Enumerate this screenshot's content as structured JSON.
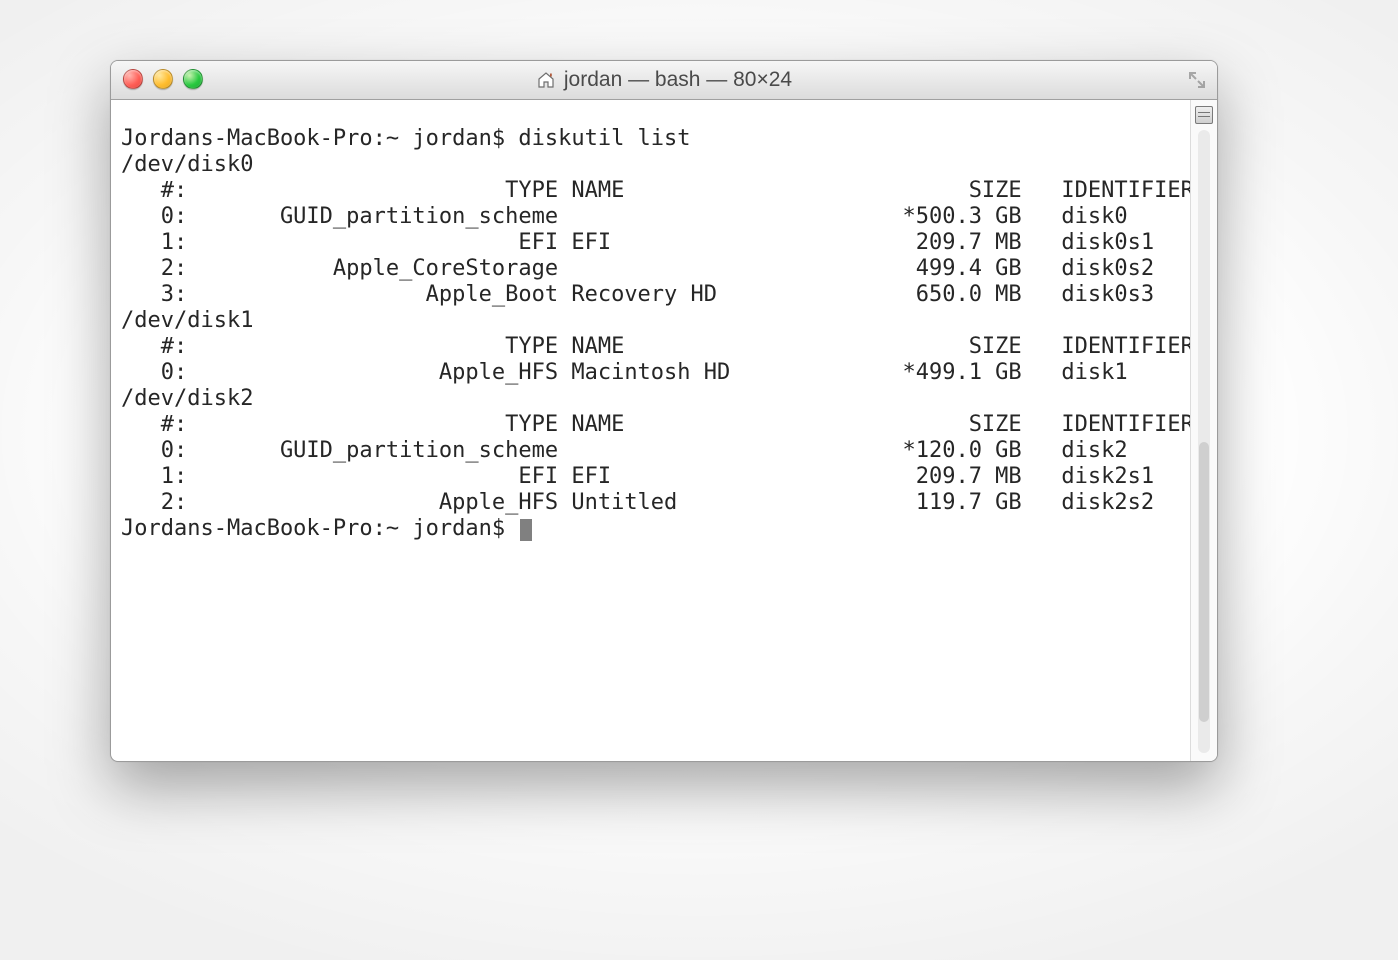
{
  "window": {
    "title": "jordan — bash — 80×24"
  },
  "terminal": {
    "prompt": "Jordans-MacBook-Pro:~ jordan$",
    "command": "diskutil list",
    "disks": [
      {
        "device": "/dev/disk0",
        "header": {
          "idx": "#:",
          "type": "TYPE",
          "name": "NAME",
          "size": "SIZE",
          "identifier": "IDENTIFIER"
        },
        "rows": [
          {
            "idx": "0:",
            "type": "GUID_partition_scheme",
            "name": "",
            "size": "*500.3 GB",
            "identifier": "disk0"
          },
          {
            "idx": "1:",
            "type": "EFI",
            "name": "EFI",
            "size": "209.7 MB",
            "identifier": "disk0s1"
          },
          {
            "idx": "2:",
            "type": "Apple_CoreStorage",
            "name": "",
            "size": "499.4 GB",
            "identifier": "disk0s2"
          },
          {
            "idx": "3:",
            "type": "Apple_Boot",
            "name": "Recovery HD",
            "size": "650.0 MB",
            "identifier": "disk0s3"
          }
        ]
      },
      {
        "device": "/dev/disk1",
        "header": {
          "idx": "#:",
          "type": "TYPE",
          "name": "NAME",
          "size": "SIZE",
          "identifier": "IDENTIFIER"
        },
        "rows": [
          {
            "idx": "0:",
            "type": "Apple_HFS",
            "name": "Macintosh HD",
            "size": "*499.1 GB",
            "identifier": "disk1"
          }
        ]
      },
      {
        "device": "/dev/disk2",
        "header": {
          "idx": "#:",
          "type": "TYPE",
          "name": "NAME",
          "size": "SIZE",
          "identifier": "IDENTIFIER"
        },
        "rows": [
          {
            "idx": "0:",
            "type": "GUID_partition_scheme",
            "name": "",
            "size": "*120.0 GB",
            "identifier": "disk2"
          },
          {
            "idx": "1:",
            "type": "EFI",
            "name": "EFI",
            "size": "209.7 MB",
            "identifier": "disk2s1"
          },
          {
            "idx": "2:",
            "type": "Apple_HFS",
            "name": "Untitled",
            "size": "119.7 GB",
            "identifier": "disk2s2"
          }
        ]
      }
    ]
  }
}
